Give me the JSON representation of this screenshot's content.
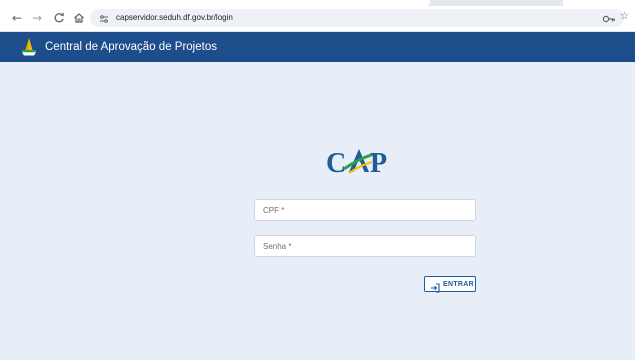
{
  "browser": {
    "url": "capservidor.seduh.df.gov.br/login",
    "icons": [
      "back-icon",
      "forward-icon",
      "reload-icon",
      "home-icon",
      "site-info-icon",
      "key-icon",
      "star-icon"
    ]
  },
  "header": {
    "title": "Central de Aprovação de Projetos",
    "background": "#1e4d8c"
  },
  "login": {
    "logo_text": "CAP",
    "cpf_label": "CPF *",
    "senha_label": "Senha *",
    "entrar_label": "ENTRAR"
  },
  "colors": {
    "page_background": "#e8eef7",
    "logo_blue": "#1f5d99",
    "logo_green": "#2e9e4a",
    "logo_yellow": "#f2c200",
    "accent": "#1e5aa6"
  }
}
